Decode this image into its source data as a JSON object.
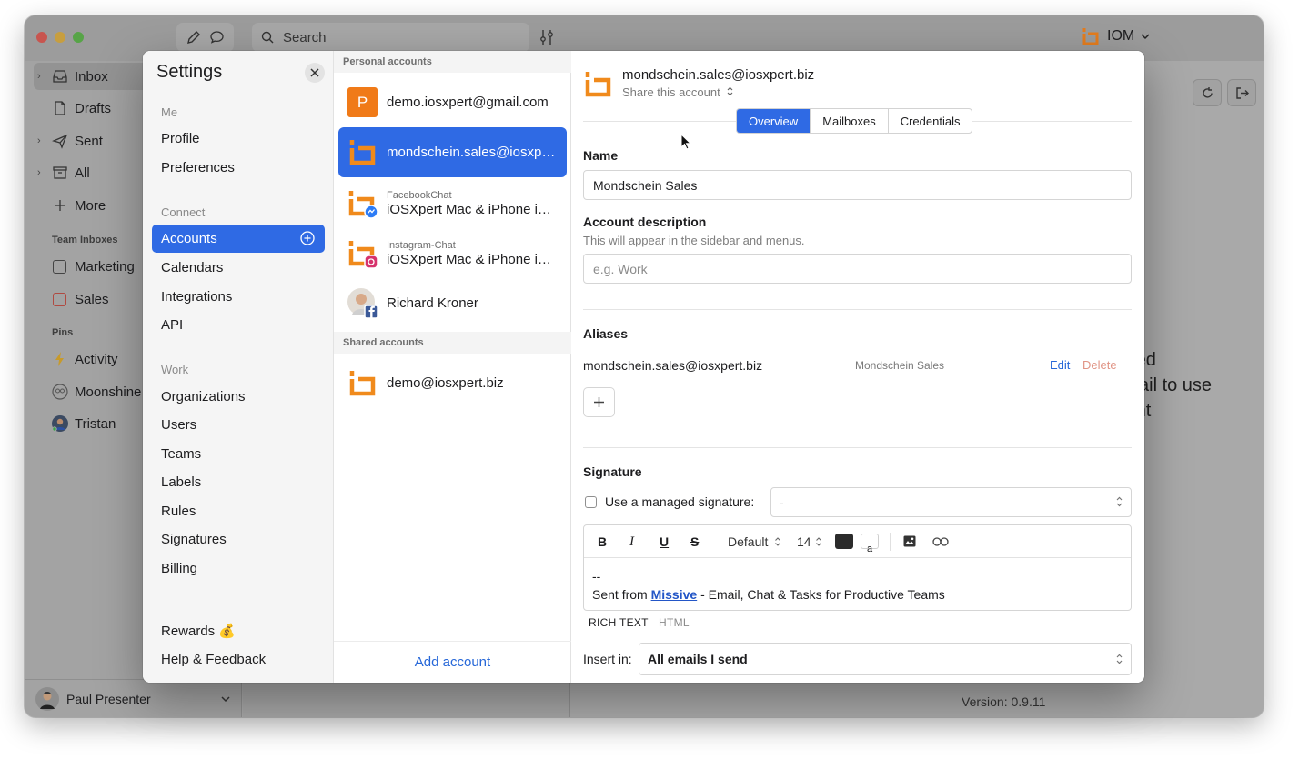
{
  "app": {
    "brand": "IOM"
  },
  "toolbar": {
    "search_placeholder": "Search"
  },
  "sidebar": {
    "items": [
      {
        "label": "Inbox"
      },
      {
        "label": "Drafts"
      },
      {
        "label": "Sent"
      },
      {
        "label": "All"
      },
      {
        "label": "More"
      }
    ],
    "team_header": "Team Inboxes",
    "teams": [
      {
        "label": "Marketing"
      },
      {
        "label": "Sales"
      }
    ],
    "pins_header": "Pins",
    "pins": [
      {
        "label": "Activity"
      },
      {
        "label": "Moonshine"
      },
      {
        "label": "Tristan"
      }
    ],
    "user": "Paul Presenter"
  },
  "background": {
    "empty_lines": [
      "ected",
      "Email to use",
      "stant"
    ],
    "version": "Version: 0.9.11"
  },
  "settings": {
    "title": "Settings",
    "me_header": "Me",
    "me": [
      "Profile",
      "Preferences"
    ],
    "connect_header": "Connect",
    "connect": [
      "Accounts",
      "Calendars",
      "Integrations",
      "API"
    ],
    "work_header": "Work",
    "work": [
      "Organizations",
      "Users",
      "Teams",
      "Labels",
      "Rules",
      "Signatures",
      "Billing"
    ],
    "rewards": "Rewards 💰",
    "help": "Help & Feedback"
  },
  "accounts": {
    "personal_header": "Personal accounts",
    "personal": [
      {
        "avatar_letter": "P",
        "sub": "",
        "name": "demo.iosxpert@gmail.com"
      },
      {
        "sub": "",
        "name": "mondschein.sales@iosxpert.biz"
      },
      {
        "sub": "FacebookChat",
        "name": "iOSXpert Mac & iPhone im Unternehmen"
      },
      {
        "sub": "Instagram-Chat",
        "name": "iOSXpert Mac & iPhone im Unternehmen"
      },
      {
        "sub": "",
        "name": "Richard Kroner"
      }
    ],
    "shared_header": "Shared accounts",
    "shared": [
      {
        "name": "demo@iosxpert.biz"
      }
    ],
    "add": "Add account",
    "colors": {
      "accent": "#2f6ae4",
      "orange": "#f08a1c"
    }
  },
  "detail": {
    "email": "mondschein.sales@iosxpert.biz",
    "share": "Share this account",
    "tabs": [
      "Overview",
      "Mailboxes",
      "Credentials"
    ],
    "name_label": "Name",
    "name_value": "Mondschein Sales",
    "desc_label": "Account description",
    "desc_hint": "This will appear in the sidebar and menus.",
    "desc_placeholder": "e.g. Work",
    "aliases_label": "Aliases",
    "alias": {
      "email": "mondschein.sales@iosxpert.biz",
      "name": "Mondschein Sales",
      "edit": "Edit",
      "delete": "Delete"
    },
    "signature_label": "Signature",
    "managed_label": "Use a managed signature:",
    "managed_value": "-",
    "toolbar": {
      "bold": "B",
      "italic": "I",
      "underline": "U",
      "strike": "S",
      "font": "Default",
      "size": "14",
      "bg_letter": "a"
    },
    "sig_line1": "--",
    "sig_prefix": "Sent from",
    "sig_link": "Missive",
    "sig_suffix": " - Email, Chat & Tasks for Productive Teams",
    "mode_rich": "RICH TEXT",
    "mode_html": "HTML",
    "insert_label": "Insert in:",
    "insert_value": "All emails I send"
  }
}
